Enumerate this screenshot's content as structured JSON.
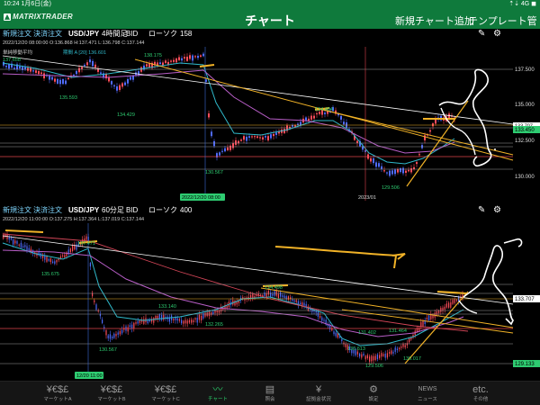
{
  "status": {
    "time_date": "10:24  1月6日(金)",
    "right": "⇡⇣ 4G ◼"
  },
  "header": {
    "logo": "MATRIXTRADER",
    "title": "チャート",
    "add_chart": "新規チャート追加",
    "template_mgmt": "テンプレート管理"
  },
  "top_chart": {
    "order_new": "新規注文",
    "order_settle": "決済注文",
    "symbol": "USD/JPY",
    "timeframe": "4時間足",
    "side": "BID",
    "chart_type": "ローソク",
    "count": "158",
    "info": "2022/12/20 08:00:00   O:136.868  H:137.471  L:136.798  C:137.144",
    "indicator": "単純移動平均",
    "indicator2": "期間 A [20]  136.601",
    "y_ticks": [
      "137.500",
      "135.000",
      "132.500",
      "130.000"
    ],
    "right_labels": [
      {
        "text": "133.450",
        "color": "#2ecc71",
        "text_color": "#000"
      },
      {
        "text": "133.707",
        "color": "#ffffff",
        "text_color": "#000"
      }
    ],
    "value_labels": {
      "v1": "137.658",
      "v2": "138.175",
      "v3": "135.593",
      "v4": "134.429",
      "v5": "130.567",
      "v6": "134.484",
      "v7": "129.506"
    },
    "x_labels": {
      "a": "2022/12/20 08:00",
      "b": "2023/01"
    }
  },
  "bottom_chart": {
    "order_new": "新規注文",
    "order_settle": "決済注文",
    "symbol": "USD/JPY",
    "timeframe": "60分足",
    "side": "BID",
    "chart_type": "ローソク",
    "count": "400",
    "info": "2022/12/20 11:00:00   O:137.275  H:137.364  L:137.019  C:137.144",
    "right_labels": [
      {
        "text": "133.707",
        "color": "#ffffff",
        "text_color": "#000"
      },
      {
        "text": "129.133",
        "color": "#2ecc71",
        "text_color": "#000"
      }
    ],
    "value_labels": {
      "v1": "137.471",
      "v2": "135.675",
      "v3": "134.498",
      "v4": "133.140",
      "v5": "132.265",
      "v6": "130.567",
      "v7": "131.402",
      "v8": "131.464",
      "v9": "130.613",
      "v10": "129.506",
      "v11": "130.017"
    },
    "x_label": "12/20 11:00"
  },
  "tabs": [
    {
      "icon": "¥€$£",
      "label": "マーケットA"
    },
    {
      "icon": "¥€$£",
      "label": "マーケットB"
    },
    {
      "icon": "¥€$£",
      "label": "マーケットC"
    },
    {
      "icon": "〰",
      "label": "チャート"
    },
    {
      "icon": "▤",
      "label": "照会"
    },
    {
      "icon": "¥",
      "label": "証拠金状況"
    },
    {
      "icon": "⚙",
      "label": "設定"
    },
    {
      "icon": "NEWS",
      "label": "ニュース"
    },
    {
      "icon": "etc.",
      "label": "その他"
    }
  ],
  "colors": {
    "accent": "#0f7a3c",
    "active_tab": "#2bd36d",
    "bull": "#ff4d5a",
    "bear": "#4f6bff",
    "ma1": "#2fb8c9",
    "ma2": "#b85ec7",
    "drawing": "#f1b227"
  }
}
